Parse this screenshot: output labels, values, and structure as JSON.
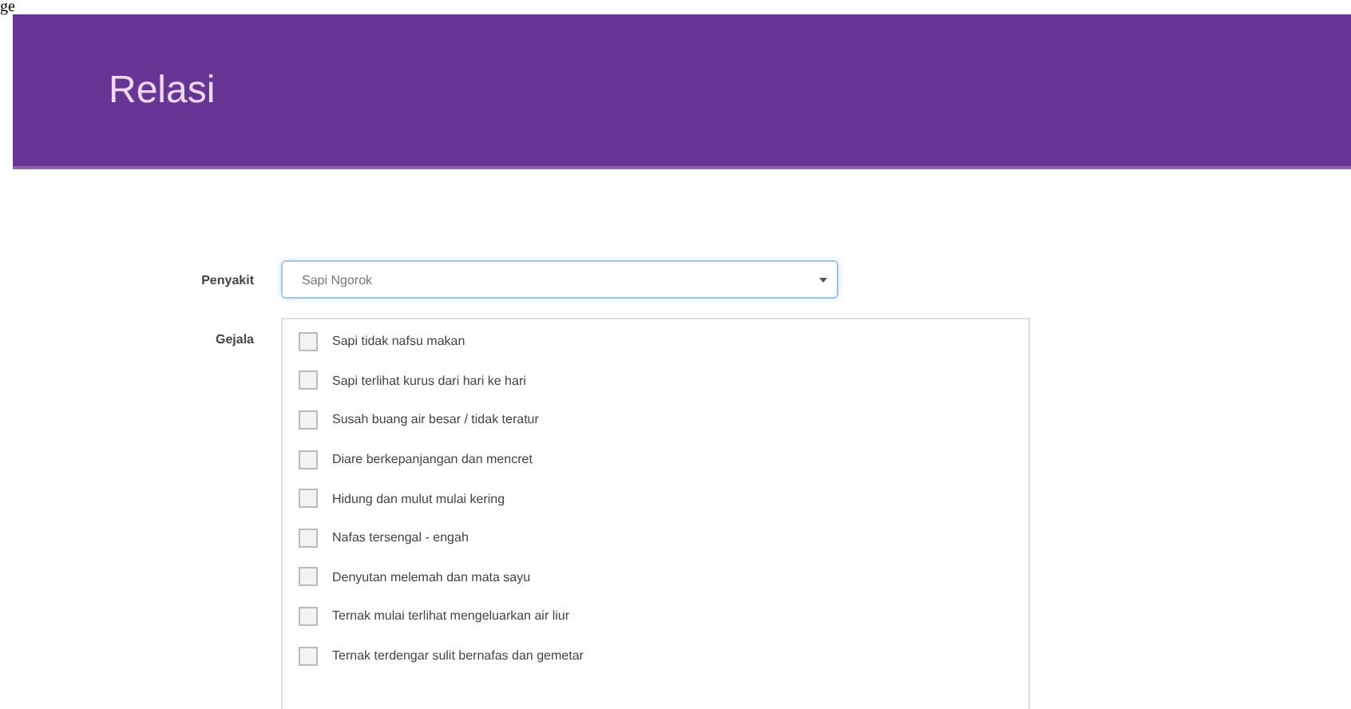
{
  "stray_text": "ge",
  "header": {
    "title": "Relasi"
  },
  "form": {
    "disease_label": "Penyakit",
    "disease_value": "Sapi Ngorok",
    "symptoms_label": "Gejala",
    "symptoms": [
      {
        "label": "Sapi tidak nafsu makan",
        "checked": false
      },
      {
        "label": "Sapi terlihat kurus dari hari ke hari",
        "checked": false
      },
      {
        "label": "Susah buang air besar / tidak teratur",
        "checked": false
      },
      {
        "label": "Diare berkepanjangan dan mencret",
        "checked": false
      },
      {
        "label": "Hidung dan mulut mulai kering",
        "checked": false
      },
      {
        "label": "Nafas tersengal - engah",
        "checked": false
      },
      {
        "label": "Denyutan melemah dan mata sayu",
        "checked": false
      },
      {
        "label": "Ternak mulai terlihat mengeluarkan air liur",
        "checked": false
      },
      {
        "label": "Ternak terdengar sulit bernafas dan gemetar",
        "checked": false
      }
    ]
  }
}
